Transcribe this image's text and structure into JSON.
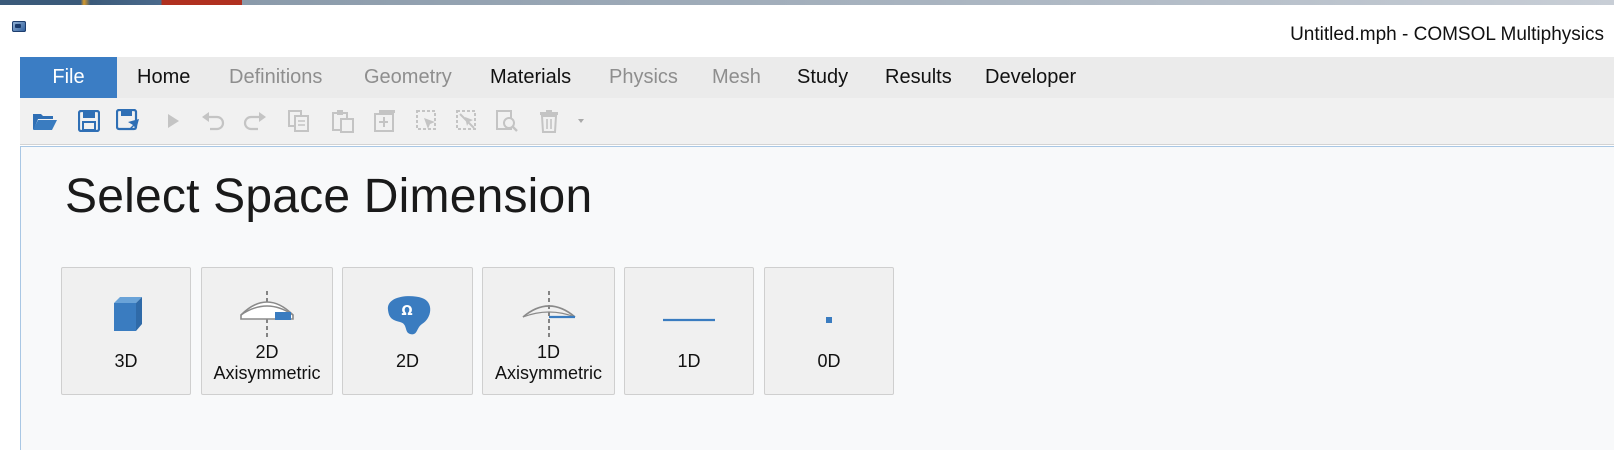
{
  "window": {
    "title": "Untitled.mph - COMSOL Multiphysics"
  },
  "ribbon": {
    "tabs": [
      {
        "label": "File",
        "state": "active"
      },
      {
        "label": "Home",
        "state": "enabled"
      },
      {
        "label": "Definitions",
        "state": "disabled"
      },
      {
        "label": "Geometry",
        "state": "disabled"
      },
      {
        "label": "Materials",
        "state": "enabled"
      },
      {
        "label": "Physics",
        "state": "disabled"
      },
      {
        "label": "Mesh",
        "state": "disabled"
      },
      {
        "label": "Study",
        "state": "enabled"
      },
      {
        "label": "Results",
        "state": "enabled"
      },
      {
        "label": "Developer",
        "state": "enabled"
      }
    ]
  },
  "quick_access": {
    "icons": [
      "open-icon",
      "save-icon",
      "save-as-icon",
      "run-icon",
      "undo-icon",
      "redo-icon",
      "copy-icon",
      "paste-icon",
      "duplicate-icon",
      "select-icon",
      "deselect-icon",
      "find-icon",
      "delete-icon",
      "customize-dropdown-icon"
    ]
  },
  "main": {
    "title": "Select Space Dimension",
    "dimensions": [
      {
        "line1": "3D",
        "line2": "",
        "icon": "cube-3d-icon"
      },
      {
        "line1": "2D",
        "line2": "Axisymmetric",
        "icon": "axisymmetric-2d-icon"
      },
      {
        "line1": "2D",
        "line2": "",
        "icon": "omega-2d-icon"
      },
      {
        "line1": "1D",
        "line2": "Axisymmetric",
        "icon": "axisymmetric-1d-icon"
      },
      {
        "line1": "1D",
        "line2": "",
        "icon": "line-1d-icon"
      },
      {
        "line1": "0D",
        "line2": "",
        "icon": "point-0d-icon"
      }
    ]
  },
  "colors": {
    "accent": "#3b7dc4",
    "icon_blue": "#3a7cc0",
    "tab_bar": "#ebebeb",
    "toolbar": "#f1f1f1",
    "content_bg": "#f8f9fa",
    "disabled_text": "#8e8e8e"
  }
}
